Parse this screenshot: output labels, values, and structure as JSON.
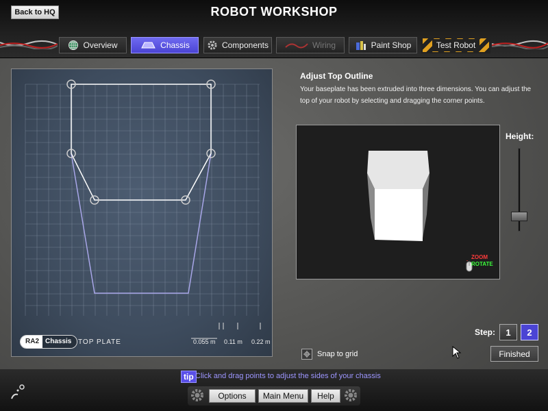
{
  "header": {
    "back_label": "Back to HQ",
    "title": "ROBOT WORKSHOP"
  },
  "tabs": [
    {
      "label": "Overview",
      "icon": "globe-icon",
      "state": "normal"
    },
    {
      "label": "Chassis",
      "icon": "chassis-icon",
      "state": "active"
    },
    {
      "label": "Components",
      "icon": "gear-icon",
      "state": "normal"
    },
    {
      "label": "Wiring",
      "icon": "wire-icon",
      "state": "disabled"
    },
    {
      "label": "Paint Shop",
      "icon": "paint-can-icon",
      "state": "normal"
    },
    {
      "label": "Test Robot",
      "icon": "hazard-stripes",
      "state": "normal"
    }
  ],
  "grid_panel": {
    "badge_left": "RA2",
    "badge_right": "Chassis",
    "plate_label": "TOP PLATE",
    "scale": [
      "0.055 m",
      "0.11 m",
      "0.22 m"
    ]
  },
  "info": {
    "title": "Adjust Top Outline",
    "text": "Your baseplate has been extruded into three dimensions. You can adjust the top of your robot by selecting and dragging the corner points."
  },
  "preview": {
    "zoom_label": "ZOOM",
    "rotate_label": "ROTATE"
  },
  "height": {
    "label": "Height:",
    "value_fraction": 0.18
  },
  "steps": {
    "label": "Step:",
    "items": [
      "1",
      "2"
    ],
    "active": "2"
  },
  "finished_label": "Finished",
  "snap_label": "Snap to grid",
  "tip": {
    "badge": "tip",
    "text": "Click and drag points to adjust the sides of your chassis"
  },
  "menu": {
    "options": "Options",
    "main_menu": "Main Menu",
    "help": "Help"
  },
  "colors": {
    "accent": "#4b44d4",
    "tip_text": "#9d96ff",
    "grid_bg": "#3e4c5e",
    "zoom": "#ff3b3b",
    "rotate": "#3bff3b"
  }
}
